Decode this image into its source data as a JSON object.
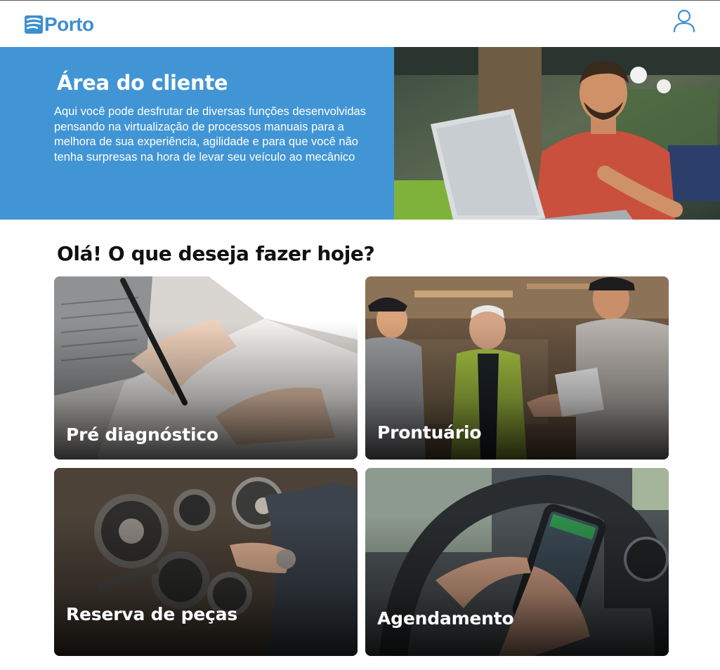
{
  "header": {
    "logo_text": "Porto",
    "logo_icon": "porto-logo-mark",
    "user_icon": "user-icon",
    "accent_color": "#3d8fd0"
  },
  "hero": {
    "title": "Área do cliente",
    "description": "Aqui você pode desfrutar de diversas funções desenvolvidas pensando na virtualização de processos manuais para a melhora de sua experiência, agilidade e para que você não tenha surpresas na hora de levar seu veículo ao mecânico",
    "background_color": "#4195d5"
  },
  "main": {
    "greeting": "Olá! O que deseja fazer hoje?",
    "cards": [
      {
        "label": "Pré diagnóstico"
      },
      {
        "label": "Prontuário"
      },
      {
        "label": "Reserva de peças"
      },
      {
        "label": "Agendamento"
      }
    ]
  }
}
